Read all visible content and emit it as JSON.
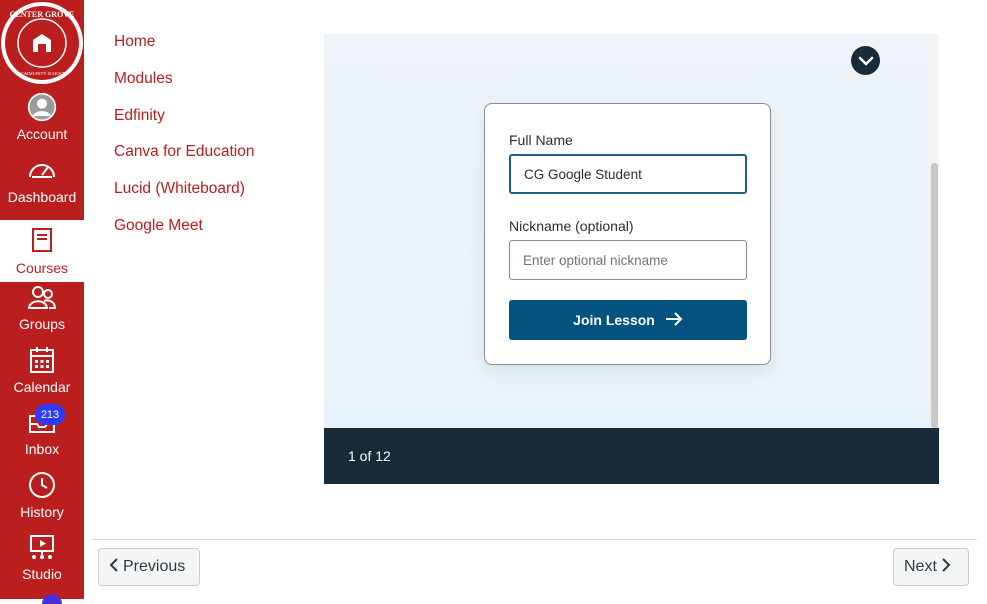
{
  "global_nav": {
    "logo_text": "CENTER GROVE COMMUNITY SCHOOL CORPORATION",
    "items": [
      {
        "label": "Account",
        "icon": "account-icon"
      },
      {
        "label": "Dashboard",
        "icon": "dashboard-icon"
      },
      {
        "label": "Courses",
        "icon": "courses-icon"
      },
      {
        "label": "Groups",
        "icon": "groups-icon"
      },
      {
        "label": "Calendar",
        "icon": "calendar-icon"
      },
      {
        "label": "Inbox",
        "icon": "inbox-icon",
        "badge": "213"
      },
      {
        "label": "History",
        "icon": "history-icon"
      },
      {
        "label": "Studio",
        "icon": "studio-icon"
      }
    ],
    "colors": {
      "brand": "#bb1e1e",
      "badge": "#2d3aff"
    }
  },
  "course_nav": {
    "links": [
      "Home",
      "Modules",
      "Edfinity",
      "Canva for Education",
      "Lucid (Whiteboard)",
      "Google Meet"
    ]
  },
  "lesson": {
    "full_name_label": "Full Name",
    "full_name_value": "CG Google Student",
    "nickname_label": "Nickname (optional)",
    "nickname_placeholder": "Enter optional nickname",
    "join_label": "Join Lesson",
    "slide_counter": "1 of 12"
  },
  "pager": {
    "previous": "Previous",
    "next": "Next"
  }
}
